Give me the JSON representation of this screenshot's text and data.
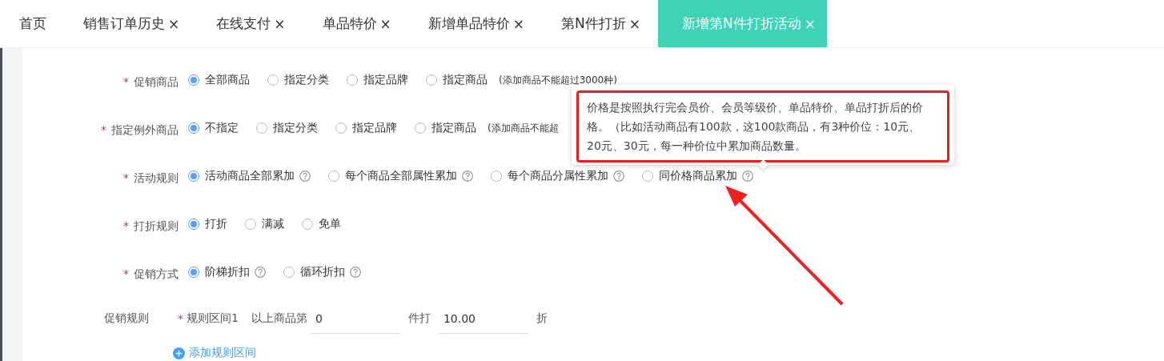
{
  "tabs": [
    {
      "label": "首页",
      "selected": false
    },
    {
      "label": "销售订单历史",
      "close": "×",
      "selected": false
    },
    {
      "label": "在线支付",
      "close": "×",
      "selected": false
    },
    {
      "label": "单品特价",
      "close": "×",
      "selected": false
    },
    {
      "label": "新增单品特价",
      "close": "×",
      "selected": false
    },
    {
      "label": "第N件打折",
      "close": "×",
      "selected": false
    },
    {
      "label": "新增第N件打折活动",
      "close": "×",
      "selected": true
    }
  ],
  "form": {
    "rows": [
      {
        "kind": "radio",
        "label": "促销商品",
        "required": true,
        "options": [
          {
            "label": "全部商品",
            "selected": true,
            "help": false
          },
          {
            "label": "指定分类",
            "selected": false,
            "help": false
          },
          {
            "label": "指定品牌",
            "selected": false,
            "help": false
          },
          {
            "label": "指定商品",
            "selected": false,
            "help": false
          }
        ],
        "note": "(添加商品不能超过3000种)"
      },
      {
        "kind": "radio",
        "label": "指定例外商品",
        "required": true,
        "options": [
          {
            "label": "不指定",
            "selected": true,
            "help": false
          },
          {
            "label": "指定分类",
            "selected": false,
            "help": false
          },
          {
            "label": "指定品牌",
            "selected": false,
            "help": false
          },
          {
            "label": "指定商品",
            "selected": false,
            "help": false
          }
        ],
        "note": "(添加商品不能超"
      },
      {
        "kind": "radio",
        "label": "活动规则",
        "required": true,
        "options": [
          {
            "label": "活动商品全部累加",
            "selected": true,
            "help": true
          },
          {
            "label": "每个商品全部属性累加",
            "selected": false,
            "help": true
          },
          {
            "label": "每个商品分属性累加",
            "selected": false,
            "help": true
          },
          {
            "label": "同价格商品累加",
            "selected": false,
            "help": true
          }
        ]
      },
      {
        "kind": "radio",
        "label": "打折规则",
        "required": true,
        "options": [
          {
            "label": "打折",
            "selected": true,
            "help": false
          },
          {
            "label": "满减",
            "selected": false,
            "help": false
          },
          {
            "label": "免单",
            "selected": false,
            "help": false
          }
        ]
      },
      {
        "kind": "radio",
        "label": "促销方式",
        "required": true,
        "options": [
          {
            "label": "阶梯折扣",
            "selected": true,
            "help": true
          },
          {
            "label": "循环折扣",
            "selected": false,
            "help": true
          }
        ]
      },
      {
        "kind": "rule",
        "label": "促销规则",
        "required": false,
        "interval": "规则区间1",
        "prefix": "以上商品第",
        "count": "0",
        "mid": "件打",
        "discount": "10.00",
        "suffix": "折"
      }
    ],
    "add_link": "添加规则区间"
  },
  "required_mark": "*",
  "tooltip": {
    "text": "价格是按照执行完会员价、会员等级价、单品特价、单品打折后的价格。（比如活动商品有100款，这100款商品，有3种价位：10元、20元、30元，每一种价位中累加商品数量。"
  }
}
